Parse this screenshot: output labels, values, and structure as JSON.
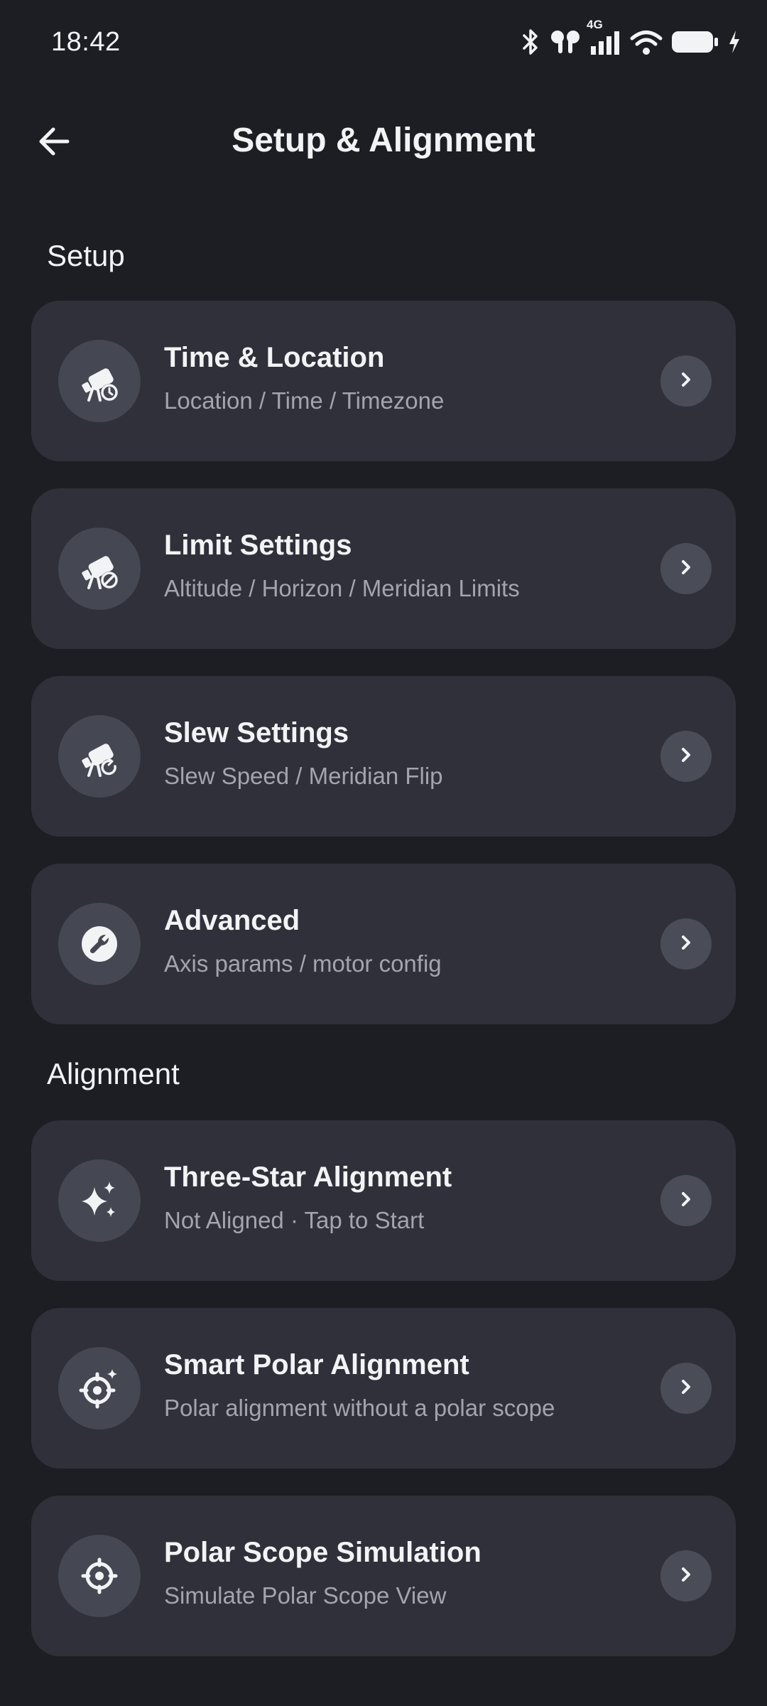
{
  "status_bar": {
    "time": "18:42",
    "network": "4G",
    "icons": [
      "bluetooth-icon",
      "earbuds-icon",
      "cellular-signal-icon",
      "wifi-icon",
      "battery-icon",
      "charging-bolt-icon"
    ]
  },
  "header": {
    "title": "Setup & Alignment",
    "back_icon": "arrow-left-icon"
  },
  "sections": {
    "setup": {
      "label": "Setup",
      "items": [
        {
          "title": "Time & Location",
          "subtitle": "Location / Time / Timezone",
          "icon": "telescope-clock-icon"
        },
        {
          "title": "Limit Settings",
          "subtitle": "Altitude / Horizon / Meridian Limits",
          "icon": "telescope-limit-icon"
        },
        {
          "title": "Slew Settings",
          "subtitle": "Slew Speed / Meridian Flip",
          "icon": "telescope-rotate-icon"
        },
        {
          "title": "Advanced",
          "subtitle": "Axis params / motor config",
          "icon": "wrench-icon"
        }
      ]
    },
    "alignment": {
      "label": "Alignment",
      "items": [
        {
          "title": "Three-Star Alignment",
          "subtitle": "Not Aligned · Tap to Start",
          "icon": "sparkle-stars-icon"
        },
        {
          "title": "Smart Polar Alignment",
          "subtitle": "Polar alignment without a polar scope",
          "icon": "crosshair-sparkle-icon"
        },
        {
          "title": "Polar Scope Simulation",
          "subtitle": "Simulate Polar Scope View",
          "icon": "crosshair-icon"
        }
      ]
    }
  },
  "colors": {
    "background": "#1d1e23",
    "card": "#2f3039",
    "icon_circle": "#454752",
    "chevron_circle": "#4a4c57",
    "text_primary": "#f2f3f5",
    "text_secondary": "#a3a5ae"
  }
}
